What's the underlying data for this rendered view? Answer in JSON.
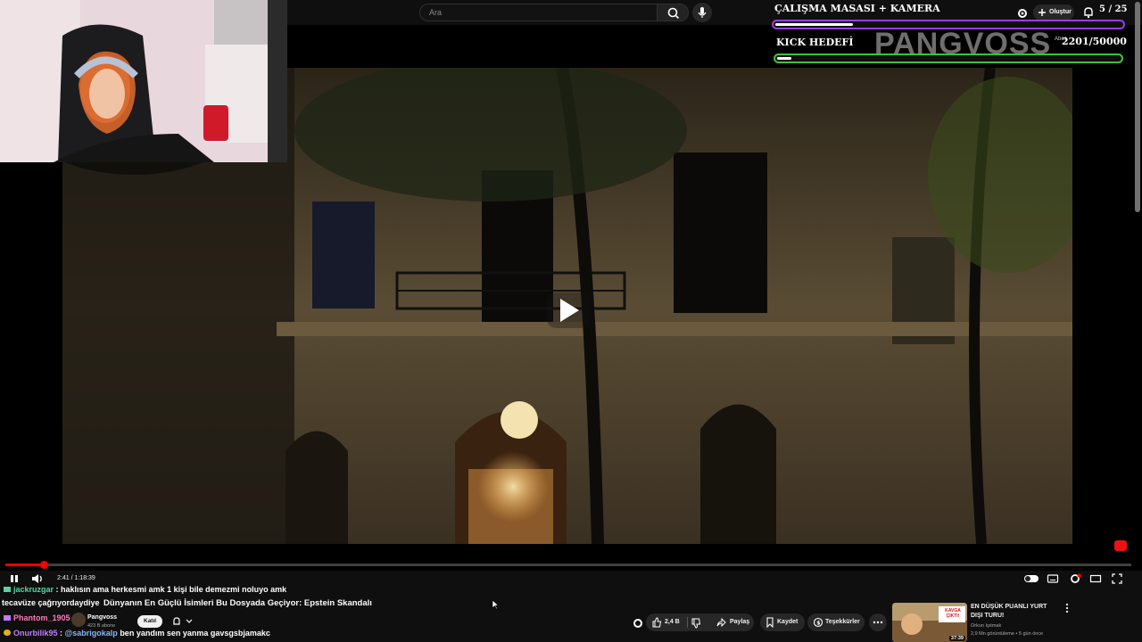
{
  "search": {
    "placeholder": "Ara"
  },
  "header": {
    "create_label": "Oluştur",
    "notification_count": "5 / 25"
  },
  "overlays": {
    "goal1_title": "ÇALIŞMA MASASI + KAMERA",
    "goal1_progress": 0.07,
    "goal2_title": "KICK HEDEFİ",
    "goal2_counter": "2201/50000",
    "goal2_progress": 0.04,
    "watermark": "PANGVOSS",
    "sub_label": "Abon"
  },
  "player": {
    "time": "2:41 / 1:18:39",
    "progress": 0.034
  },
  "chat": [
    {
      "user": "jackruzgar",
      "message": " : haklısın ama herkesmi amk 1 kişi bile demezmi noluyo amk"
    },
    {
      "user": "",
      "message": "tecavüze çağrıyordaydiye"
    },
    {
      "user": "Phantom_1905",
      "message": " : ?"
    },
    {
      "user": "Onurbilik95",
      "message": " : ",
      "mention": "@sabrigokalp",
      "message2": " ben yandım sen yanma gavsgsbjamakc"
    }
  ],
  "video": {
    "title": "Dünyanın En Güçlü İsimleri Bu Dosyada Geçiyor: Epstein Skandalı",
    "channel": "Pangvoss",
    "subscribers": "423 B abone",
    "join_label": "Katıl",
    "likes": "2,4 B",
    "share_label": "Paylaş",
    "save_label": "Kaydet",
    "thanks_label": "Teşekkürler"
  },
  "recommended": {
    "title": "EN DÜŞÜK PUANLI YURT DIŞI TURU!",
    "channel": "Orkun Işıtmak",
    "meta": "2,9 Mn görüntüleme • 5 gün önce",
    "duration": "37:39",
    "thumb_text": "KAVGA ÇIKTI!"
  },
  "colors": {
    "accent": "#ff0000",
    "goal1_border": "#9a3fe0",
    "goal2_border": "#3cc23c"
  }
}
